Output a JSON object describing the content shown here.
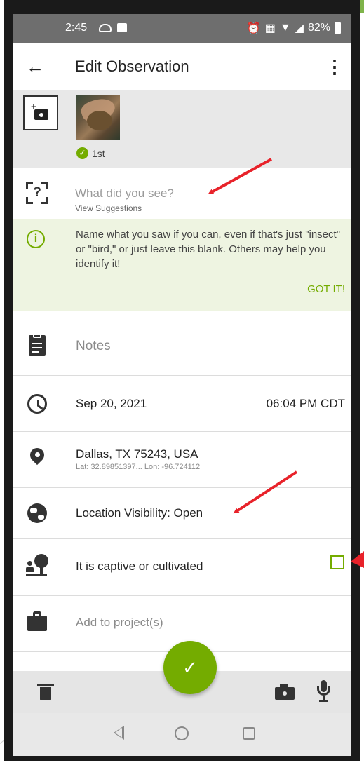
{
  "status_bar": {
    "time": "2:45",
    "battery": "82%"
  },
  "app_bar": {
    "back_icon": "arrow-left-icon",
    "title": "Edit Observation",
    "menu_icon": "more-vert-icon"
  },
  "photos": {
    "add_photo_icon": "add-photo-icon",
    "first_badge": "1st"
  },
  "species": {
    "placeholder": "What did you see?",
    "suggestions_label": "View Suggestions"
  },
  "tip": {
    "text": "Name what you saw if you can, even if that's just \"insect\" or \"bird,\" or just leave this blank. Others may help you identify it!",
    "dismiss_label": "GOT IT!"
  },
  "notes": {
    "placeholder": "Notes"
  },
  "datetime": {
    "date": "Sep 20, 2021",
    "time": "06:04 PM CDT"
  },
  "location": {
    "place": "Dallas, TX 75243, USA",
    "coords": "Lat: 32.89851397...  Lon: -96.724112"
  },
  "visibility": {
    "label": "Location Visibility: Open"
  },
  "captive": {
    "label": "It is captive or cultivated",
    "checked": false
  },
  "projects": {
    "label": "Add to project(s)"
  },
  "colors": {
    "accent": "#74ac00",
    "tip_background": "#eef4e1",
    "annotation_arrow": "#e8222a"
  }
}
